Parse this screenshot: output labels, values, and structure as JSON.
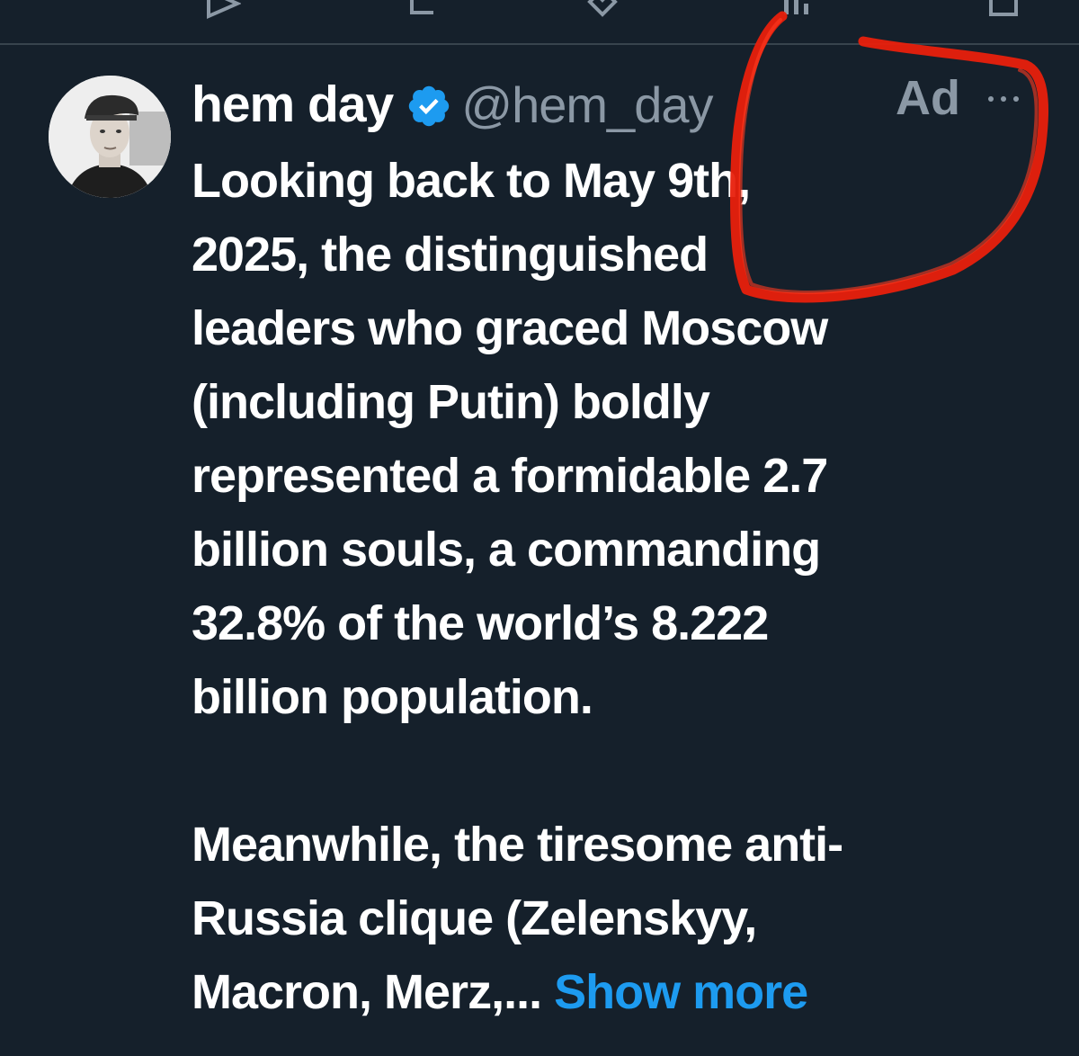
{
  "tweet": {
    "author": {
      "display_name": "hem day",
      "handle": "@hem_day",
      "verified": true
    },
    "ad_label": "Ad",
    "text_lines": [
      "Looking back to May 9th,",
      "2025, the distinguished",
      "leaders who graced Moscow",
      "(including Putin) boldly",
      "represented a formidable 2.7",
      "billion souls, a commanding",
      "32.8% of the world’s 8.222",
      "billion population."
    ],
    "text_lines_2": [
      "Meanwhile, the tiresome anti-",
      "Russia clique (Zelenskyy,"
    ],
    "last_line_text": "Macron, Merz,... ",
    "show_more_label": "Show more"
  },
  "icons": {
    "verified": "verified-badge-icon",
    "more": "more-horizontal-icon"
  },
  "colors": {
    "background": "#15202b",
    "secondary_text": "#8b98a5",
    "link": "#1d9bf0",
    "verified": "#1d9bf0",
    "annotation": "#e8200c"
  }
}
